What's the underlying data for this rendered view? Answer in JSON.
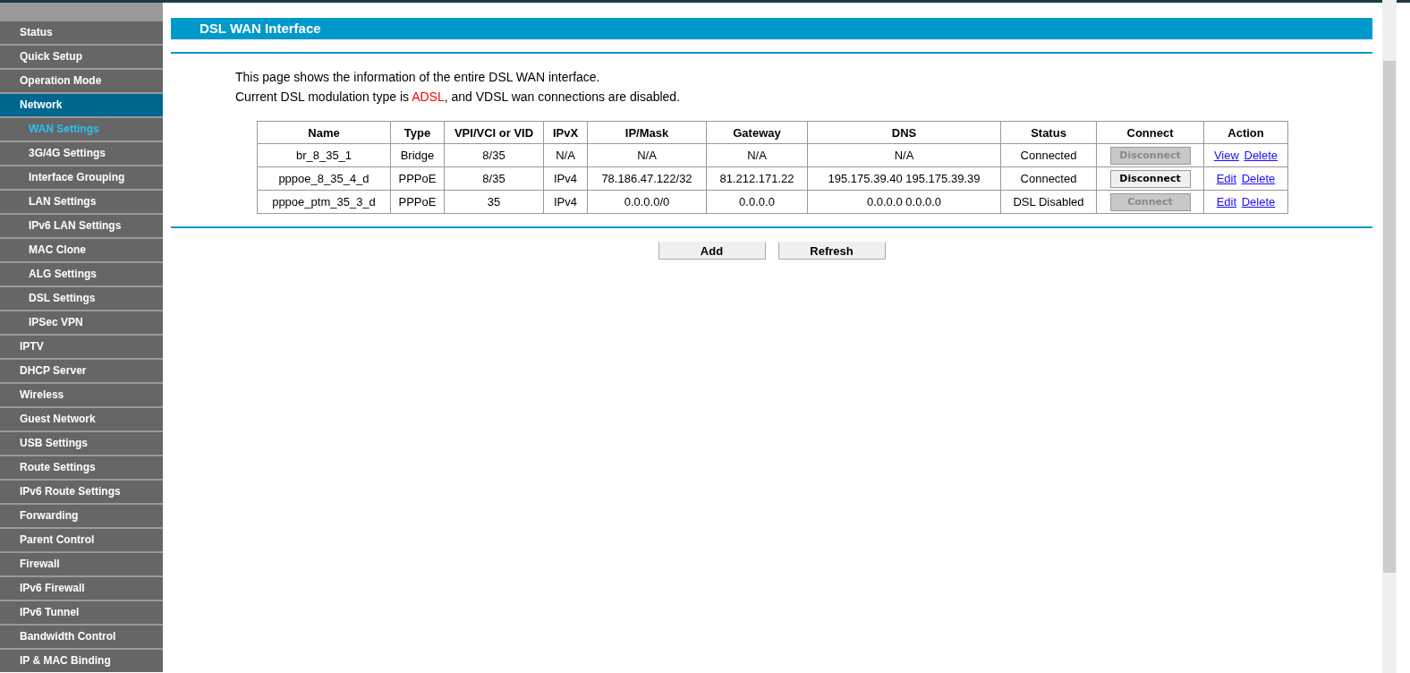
{
  "sidebar": {
    "items": [
      {
        "label": "Status",
        "selected": false
      },
      {
        "label": "Quick Setup",
        "selected": false
      },
      {
        "label": "Operation Mode",
        "selected": false
      },
      {
        "label": "Network",
        "selected": true,
        "children": [
          {
            "label": "WAN Settings",
            "selected": true
          },
          {
            "label": "3G/4G Settings",
            "selected": false
          },
          {
            "label": "Interface Grouping",
            "selected": false
          },
          {
            "label": "LAN Settings",
            "selected": false
          },
          {
            "label": "IPv6 LAN Settings",
            "selected": false
          },
          {
            "label": "MAC Clone",
            "selected": false
          },
          {
            "label": "ALG Settings",
            "selected": false
          },
          {
            "label": "DSL Settings",
            "selected": false
          },
          {
            "label": "IPSec VPN",
            "selected": false
          }
        ]
      },
      {
        "label": "IPTV",
        "selected": false
      },
      {
        "label": "DHCP Server",
        "selected": false
      },
      {
        "label": "Wireless",
        "selected": false
      },
      {
        "label": "Guest Network",
        "selected": false
      },
      {
        "label": "USB Settings",
        "selected": false
      },
      {
        "label": "Route Settings",
        "selected": false
      },
      {
        "label": "IPv6 Route Settings",
        "selected": false
      },
      {
        "label": "Forwarding",
        "selected": false
      },
      {
        "label": "Parent Control",
        "selected": false
      },
      {
        "label": "Firewall",
        "selected": false
      },
      {
        "label": "IPv6 Firewall",
        "selected": false
      },
      {
        "label": "IPv6 Tunnel",
        "selected": false
      },
      {
        "label": "Bandwidth Control",
        "selected": false
      },
      {
        "label": "IP & MAC Binding",
        "selected": false
      }
    ]
  },
  "page": {
    "title": "DSL WAN Interface",
    "description": [
      "This page shows the information of the entire DSL WAN interface.",
      "Current DSL modulation type is **ADSL**, and VDSL wan connections are disabled."
    ]
  },
  "table": {
    "columns": [
      "Name",
      "Type",
      "VPI/VCI or VID",
      "IPvX",
      "IP/Mask",
      "Gateway",
      "DNS",
      "Status",
      "Connect",
      "Action"
    ],
    "rows": [
      {
        "cells": [
          "br_8_35_1",
          "Bridge",
          "8/35",
          "N/A",
          "N/A",
          "N/A",
          "N/A",
          "Connected"
        ],
        "connect": {
          "label": "Disconnect",
          "disabled": true
        },
        "actions": [
          "View",
          "Delete"
        ]
      },
      {
        "cells": [
          "pppoe_8_35_4_d",
          "PPPoE",
          "8/35",
          "IPv4",
          "78.186.47.122/32",
          "81.212.171.22",
          "195.175.39.40 195.175.39.39",
          "Connected"
        ],
        "connect": {
          "label": "Disconnect",
          "disabled": false
        },
        "actions": [
          "Edit",
          "Delete"
        ]
      },
      {
        "cells": [
          "pppoe_ptm_35_3_d",
          "PPPoE",
          "35",
          "IPv4",
          "0.0.0.0/0",
          "0.0.0.0",
          "0.0.0.0 0.0.0.0",
          "DSL Disabled"
        ],
        "connect": {
          "label": "Connect",
          "disabled": true
        },
        "actions": [
          "Edit",
          "Delete"
        ]
      }
    ]
  },
  "buttons": [
    "Add",
    "Refresh"
  ]
}
